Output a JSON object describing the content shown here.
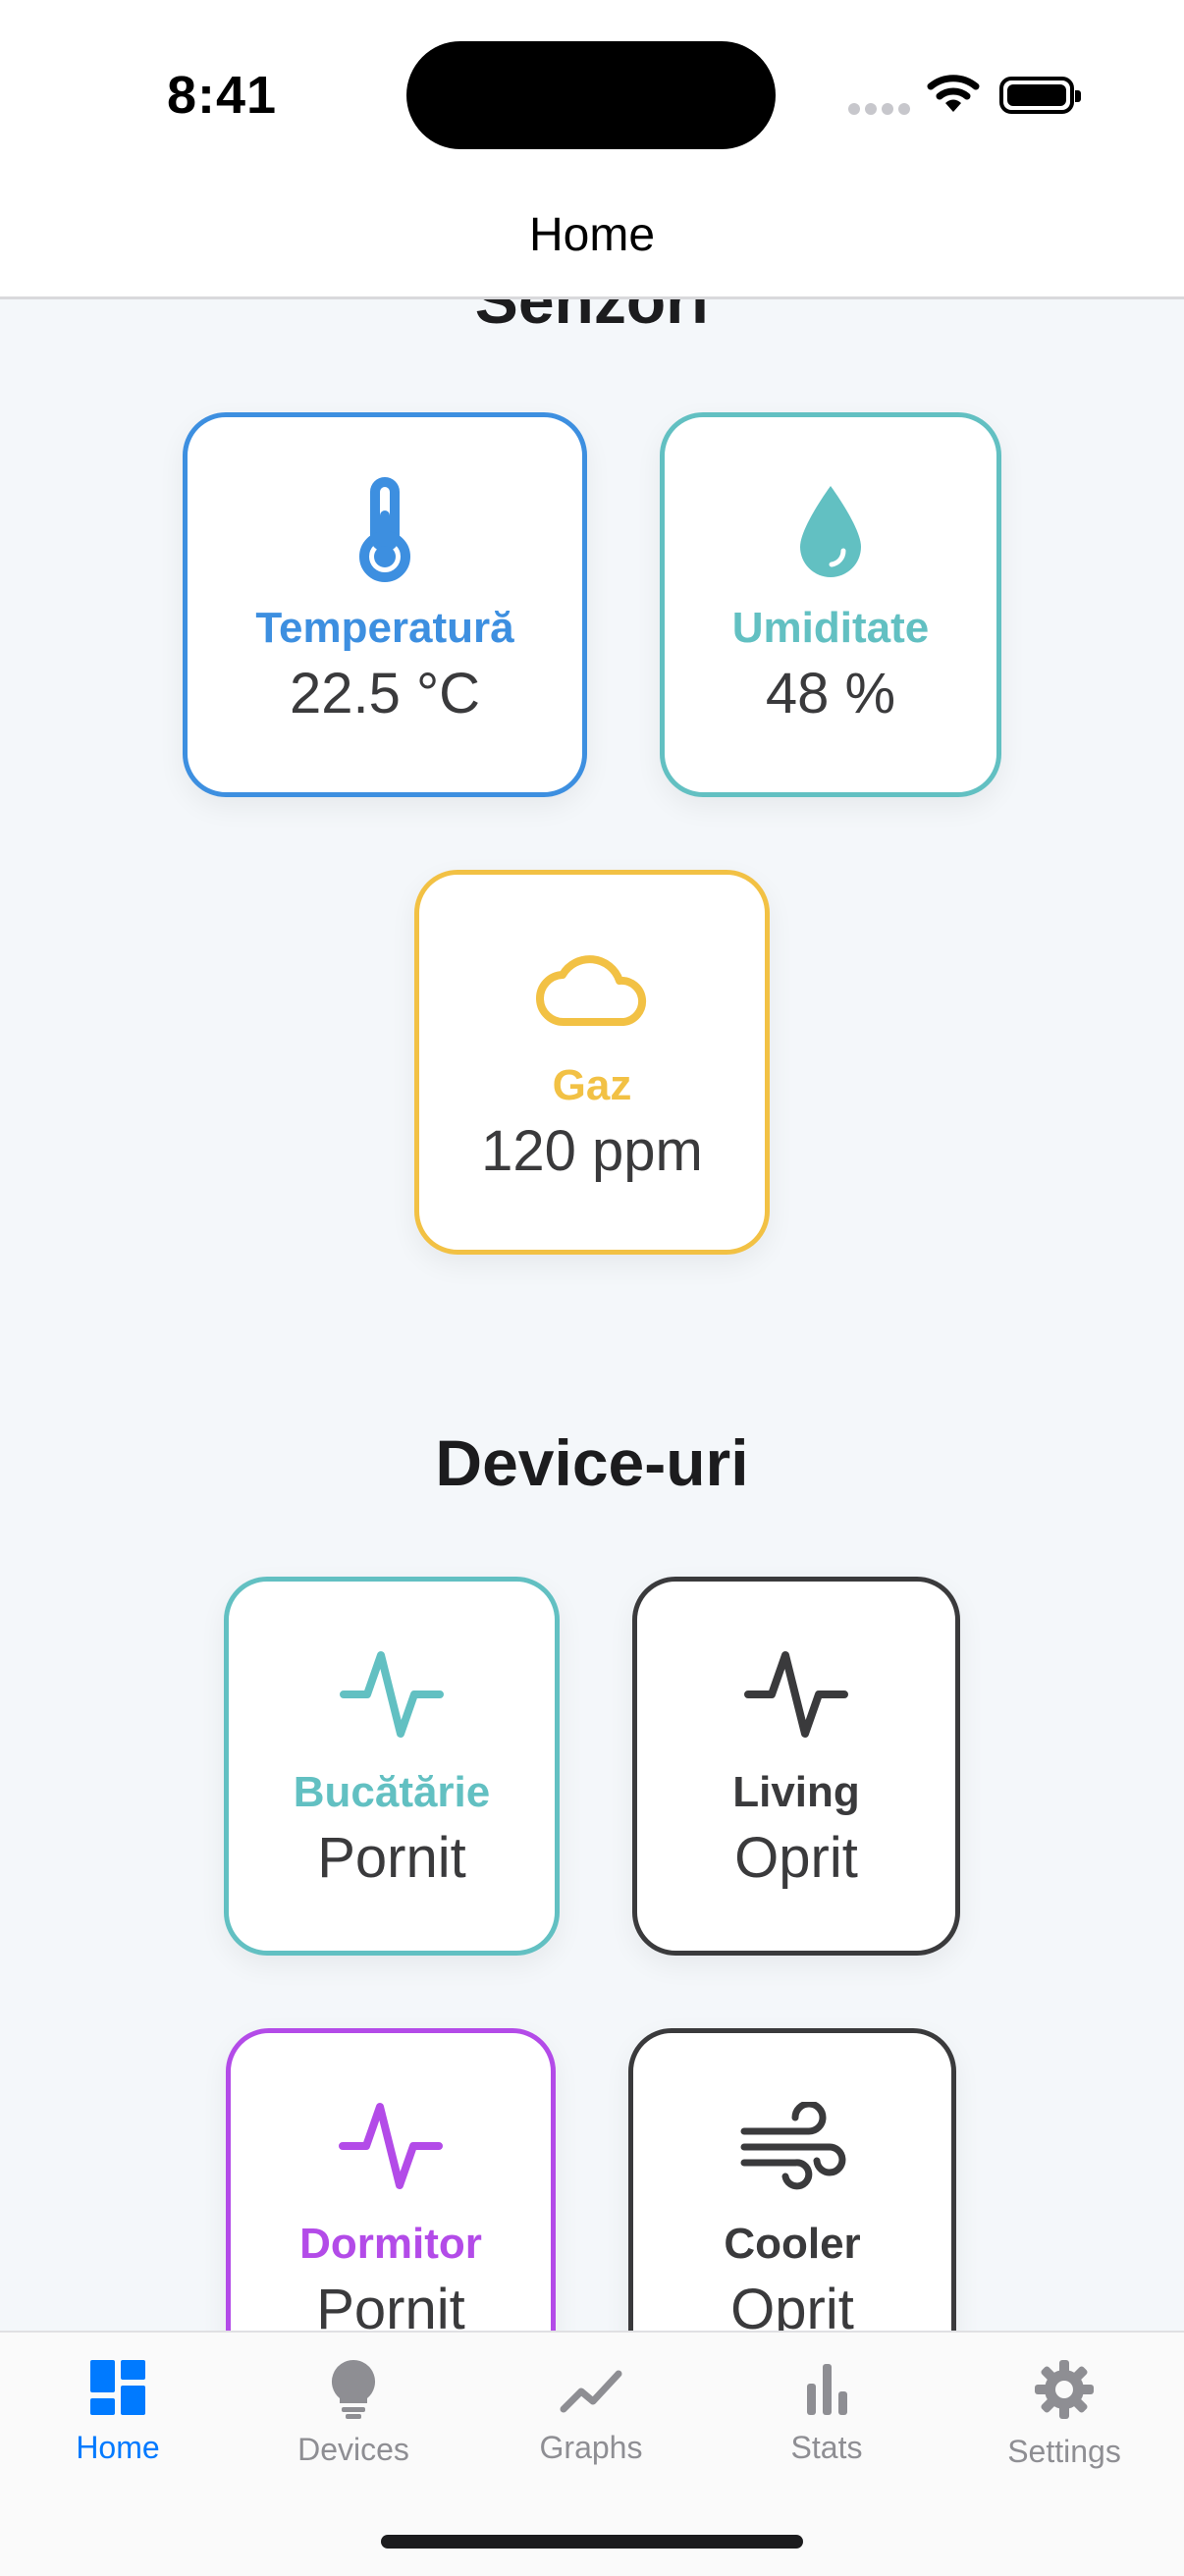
{
  "status": {
    "time": "8:41"
  },
  "header": {
    "title": "Home"
  },
  "sensors": {
    "title": "Senzori",
    "items": [
      {
        "label": "Temperatură",
        "value": "22.5 °C",
        "icon": "thermometer-icon",
        "color": "#3d8fe0"
      },
      {
        "label": "Umiditate",
        "value": "48 %",
        "icon": "droplet-icon",
        "color": "#62c0c2"
      },
      {
        "label": "Gaz",
        "value": "120 ppm",
        "icon": "cloud-icon",
        "color": "#f2c144"
      }
    ]
  },
  "devices": {
    "title": "Device-uri",
    "items": [
      {
        "label": "Bucătărie",
        "value": "Pornit",
        "icon": "activity-icon",
        "color": "#62c0c2"
      },
      {
        "label": "Living",
        "value": "Oprit",
        "icon": "activity-icon",
        "color": "#3a3a3c"
      },
      {
        "label": "Dormitor",
        "value": "Pornit",
        "icon": "activity-icon",
        "color": "#b34be8"
      },
      {
        "label": "Cooler",
        "value": "Oprit",
        "icon": "wind-icon",
        "color": "#3a3a3c"
      }
    ]
  },
  "tabbar": {
    "active": "Home",
    "items": [
      {
        "label": "Home",
        "icon": "dashboard-icon"
      },
      {
        "label": "Devices",
        "icon": "lightbulb-icon"
      },
      {
        "label": "Graphs",
        "icon": "line-chart-icon"
      },
      {
        "label": "Stats",
        "icon": "bar-chart-icon"
      },
      {
        "label": "Settings",
        "icon": "gear-icon"
      }
    ]
  }
}
